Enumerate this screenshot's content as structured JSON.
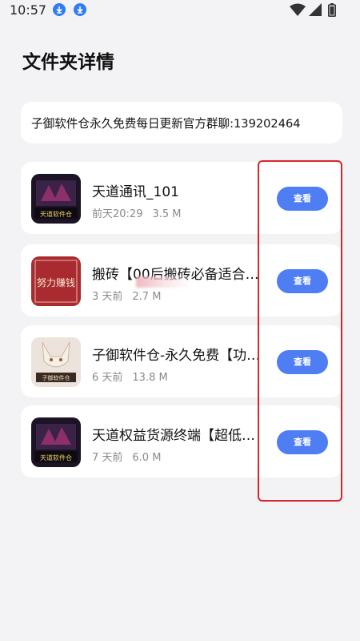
{
  "status_bar": {
    "time": "10:57",
    "icons": [
      "download-icon",
      "download-icon",
      "wifi-icon",
      "signal-icon",
      "battery-icon"
    ]
  },
  "page": {
    "title": "文件夹详情"
  },
  "notice": {
    "text": "子御软件仓永久免费每日更新官方群聊:139202464"
  },
  "files": [
    {
      "name": "天道通讯_101",
      "time": "前天20:29",
      "size": "3.5 M",
      "button": "查看",
      "icon": "app-icon-dark",
      "icon_label": "天道软件仓"
    },
    {
      "name": "搬砖【00后搬砖必备适合…",
      "time": "3 天前",
      "size": "2.7 M",
      "button": "查看",
      "icon": "app-icon-red",
      "icon_label": "努力赚钱"
    },
    {
      "name": "子御软件仓-永久免费【功…",
      "time": "6 天前",
      "size": "13.8 M",
      "button": "查看",
      "icon": "app-icon-fox",
      "icon_label": "子御软件仓"
    },
    {
      "name": "天道权益货源终端【超低…",
      "time": "7 天前",
      "size": "6.0 M",
      "button": "查看",
      "icon": "app-icon-dark",
      "icon_label": "天道软件仓"
    }
  ],
  "colors": {
    "accent": "#4e7df4",
    "background": "#f3f3f5",
    "highlight": "#d9262c"
  }
}
